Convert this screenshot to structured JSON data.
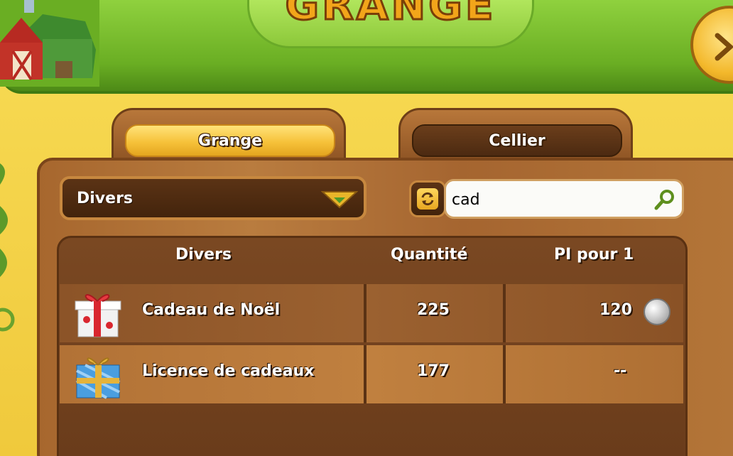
{
  "banner": {
    "title": "GRANGE"
  },
  "tabs": [
    {
      "label": "Grange",
      "active": true
    },
    {
      "label": "Cellier",
      "active": false
    }
  ],
  "filter": {
    "selected": "Divers"
  },
  "search": {
    "value": "cad",
    "placeholder": ""
  },
  "table": {
    "headers": [
      "Divers",
      "Quantité",
      "PI pour 1"
    ],
    "rows": [
      {
        "name": "Cadeau de Noël",
        "quantity": "225",
        "pi": "120",
        "icon": "gift-box-icon"
      },
      {
        "name": "Licence de cadeaux",
        "quantity": "177",
        "pi": "--",
        "icon": "gift-license-icon"
      }
    ]
  },
  "colors": {
    "banner_green": "#6aae23",
    "background_yellow": "#f4d24a",
    "wood": "#a7672e",
    "title_orange": "#f2a51a"
  }
}
